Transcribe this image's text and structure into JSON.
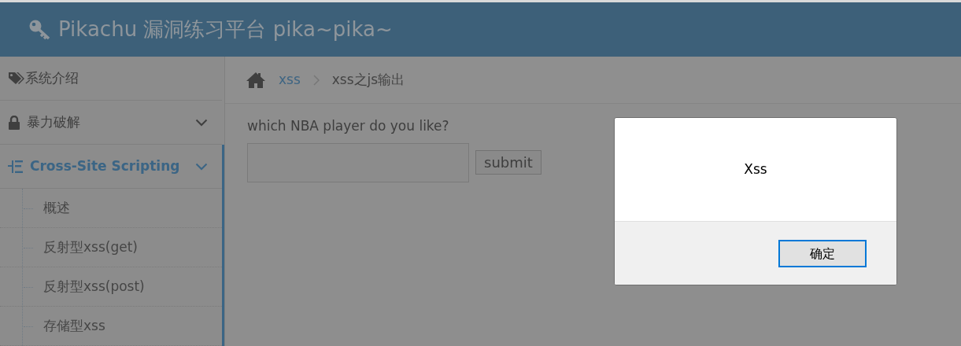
{
  "header": {
    "title": "Pikachu 漏洞练习平台 pika~pika~"
  },
  "sidebar": {
    "items": [
      {
        "label": "系统介绍",
        "kind": "tag",
        "expandable": false,
        "selected": false
      },
      {
        "label": "暴力破解",
        "kind": "lock",
        "expandable": true,
        "selected": false
      },
      {
        "label": "Cross-Site Scripting",
        "kind": "list",
        "expandable": true,
        "selected": true,
        "children": [
          {
            "label": "概述",
            "selected": false
          },
          {
            "label": "反射型xss(get)",
            "selected": false
          },
          {
            "label": "反射型xss(post)",
            "selected": false
          },
          {
            "label": "存储型xss",
            "selected": false
          }
        ]
      }
    ]
  },
  "breadcrumb": [
    {
      "label": "xss",
      "link": true
    },
    {
      "label": "xss之js输出",
      "link": false
    }
  ],
  "form": {
    "question": "which NBA player do you like?",
    "submit": "submit"
  },
  "dialog": {
    "message": "Xss",
    "button": "确定"
  }
}
